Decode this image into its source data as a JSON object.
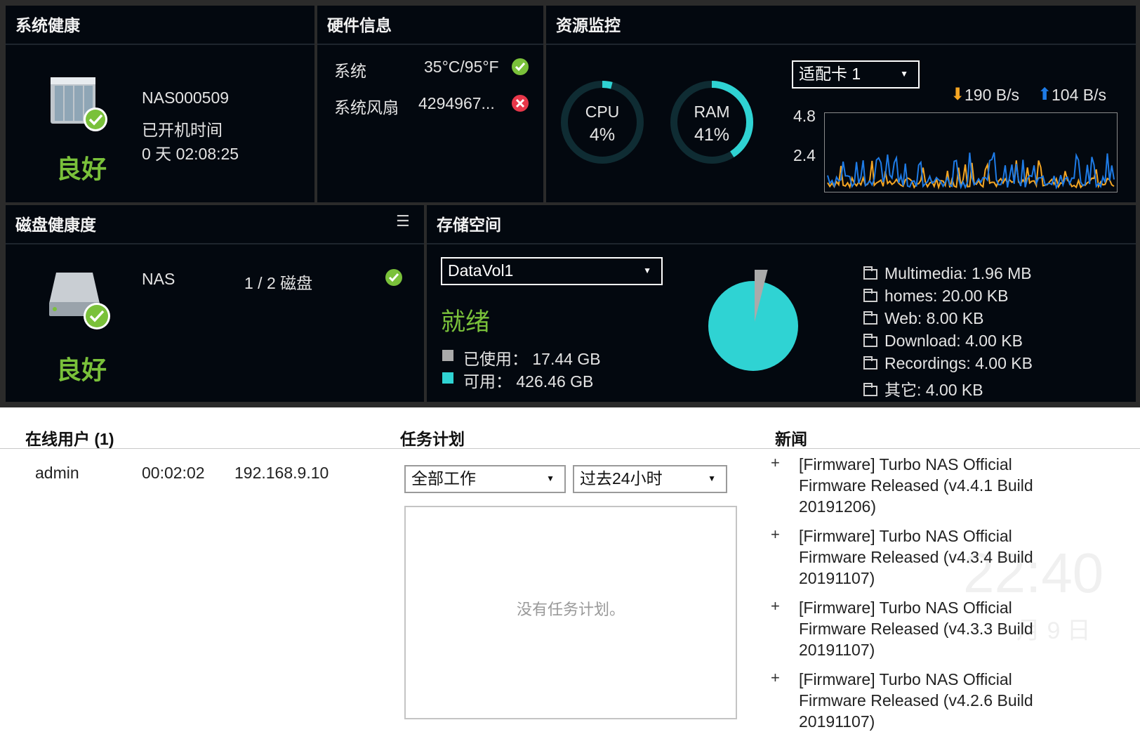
{
  "system_health": {
    "title": "系统健康",
    "name": "NAS000509",
    "uptime_label": "已开机时间",
    "uptime": "0 天 02:08:25",
    "status": "良好"
  },
  "hardware": {
    "title": "硬件信息",
    "rows": [
      {
        "label": "系统",
        "value": "35°C/95°F",
        "status": "ok"
      },
      {
        "label": "系统风扇",
        "value": "4294967...",
        "status": "error"
      }
    ]
  },
  "resource": {
    "title": "资源监控",
    "cpu_label": "CPU",
    "cpu_value": "4%",
    "cpu_percent": 4,
    "ram_label": "RAM",
    "ram_value": "41%",
    "ram_percent": 41,
    "adapter": "适配卡 1",
    "download": "190 B/s",
    "upload": "104 B/s",
    "y_ticks": [
      "4.8",
      "2.4"
    ],
    "colors": {
      "download": "#f5a623",
      "upload": "#1e7be6",
      "ring": "#2fd3d3"
    }
  },
  "disk_health": {
    "title": "磁盘健康度",
    "name": "NAS",
    "disks": "1 / 2 磁盘",
    "status": "良好"
  },
  "storage": {
    "title": "存储空间",
    "volume": "DataVol1",
    "state": "就绪",
    "used": "已使用： 17.44 GB",
    "free": "可用： 426.46 GB",
    "used_gb": 17.44,
    "free_gb": 426.46,
    "folders": [
      "Multimedia: 1.96 MB",
      "homes: 20.00 KB",
      "Web: 8.00 KB",
      "Download: 4.00 KB",
      "Recordings: 4.00 KB",
      "其它: 4.00 KB"
    ],
    "colors": {
      "used": "#aaaaaa",
      "free": "#2fd3d3"
    }
  },
  "online_users": {
    "title": "在线用户 (1)",
    "rows": [
      {
        "user": "admin",
        "time": "00:02:02",
        "ip": "192.168.9.10"
      }
    ]
  },
  "tasks": {
    "title": "任务计划",
    "filter1": "全部工作",
    "filter2": "过去24小时",
    "empty": "没有任务计划。"
  },
  "news": {
    "title": "新闻",
    "items": [
      "[Firmware] Turbo NAS Official Firmware Released (v4.4.1 Build 20191206)",
      "[Firmware] Turbo NAS Official Firmware Released (v4.3.4 Build 20191107)",
      "[Firmware] Turbo NAS Official Firmware Released (v4.3.3 Build 20191107)",
      "[Firmware] Turbo NAS Official Firmware Released (v4.2.6 Build 20191107)"
    ]
  },
  "background": {
    "clock": "22:40",
    "date": "月 9 日"
  }
}
